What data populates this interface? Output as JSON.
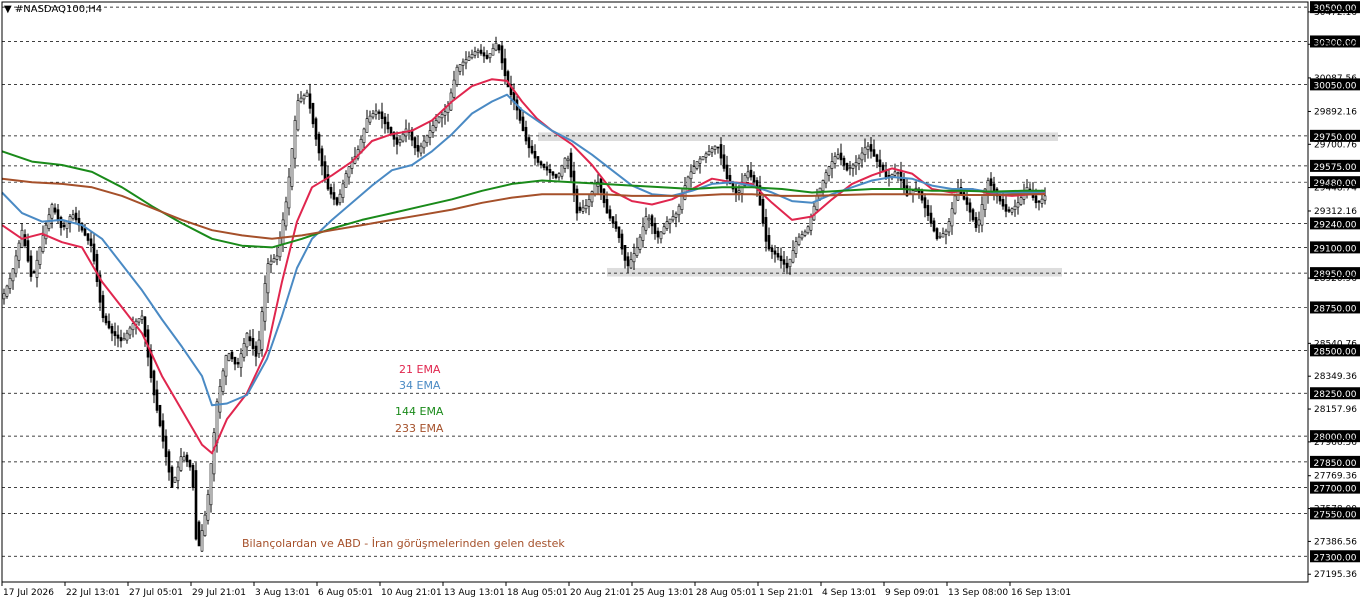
{
  "symbol": "▼ #NASDAQ100,H4",
  "colors": {
    "ema21": "#e0264e",
    "ema34": "#4a8ac4",
    "ema144": "#1a8a1a",
    "ema233": "#a5502a",
    "candle": "#000000",
    "zone": "#d9d9d9",
    "grid": "#000000",
    "note": "#a5502a"
  },
  "legend": {
    "ema21": "21 EMA",
    "ema34": "34 EMA",
    "ema144": "144 EMA",
    "ema233": "233 EMA"
  },
  "annotation": "Bilançolardan ve ABD - İran görüşmelerinden gelen destek",
  "chart_data": {
    "type": "line",
    "y_range": [
      27150,
      30530
    ],
    "x_labels": [
      "17 Jul 2026",
      "22 Jul 13:01",
      "27 Jul 05:01",
      "29 Jul 21:01",
      "3 Aug 13:01",
      "6 Aug 05:01",
      "10 Aug 21:01",
      "13 Aug 13:01",
      "18 Aug 05:01",
      "20 Aug 21:01",
      "25 Aug 13:01",
      "28 Aug 05:01",
      "1 Sep 21:01",
      "4 Sep 13:01",
      "9 Sep 09:01",
      "13 Sep 08:00",
      "16 Sep 13:01"
    ],
    "levels_boxed": [
      "30500.00",
      "30300.00",
      "30050.00",
      "29750.00",
      "29575.00",
      "29480.00",
      "29240.00",
      "29100.00",
      "28950.00",
      "28750.00",
      "28500.00",
      "28250.00",
      "28000.00",
      "27850.00",
      "27700.00",
      "27550.00",
      "27300.00"
    ],
    "levels_plain": [
      "30472.16",
      "30283.70",
      "30087.56",
      "29892.16",
      "29700.76",
      "29448.74",
      "29312.16",
      "28920.96",
      "28540.76",
      "28349.36",
      "28157.96",
      "27966.56",
      "27769.36",
      "27578.00",
      "27386.56",
      "27195.36"
    ],
    "resistance_zone": [
      29720,
      29770
    ],
    "support_zone": [
      28930,
      28980
    ],
    "series": [
      {
        "name": "21 EMA",
        "key": "ema21",
        "points": [
          [
            0,
            29230
          ],
          [
            20,
            29150
          ],
          [
            40,
            29180
          ],
          [
            60,
            29130
          ],
          [
            80,
            29100
          ],
          [
            100,
            28900
          ],
          [
            120,
            28750
          ],
          [
            140,
            28600
          ],
          [
            160,
            28350
          ],
          [
            180,
            28150
          ],
          [
            200,
            27950
          ],
          [
            210,
            27900
          ],
          [
            225,
            28100
          ],
          [
            245,
            28250
          ],
          [
            265,
            28500
          ],
          [
            280,
            28900
          ],
          [
            295,
            29250
          ],
          [
            310,
            29450
          ],
          [
            330,
            29520
          ],
          [
            350,
            29600
          ],
          [
            370,
            29720
          ],
          [
            390,
            29760
          ],
          [
            410,
            29780
          ],
          [
            430,
            29840
          ],
          [
            450,
            29950
          ],
          [
            470,
            30040
          ],
          [
            490,
            30080
          ],
          [
            505,
            30070
          ],
          [
            520,
            29950
          ],
          [
            535,
            29850
          ],
          [
            550,
            29780
          ],
          [
            570,
            29700
          ],
          [
            590,
            29580
          ],
          [
            610,
            29430
          ],
          [
            630,
            29370
          ],
          [
            650,
            29350
          ],
          [
            670,
            29380
          ],
          [
            690,
            29440
          ],
          [
            710,
            29500
          ],
          [
            730,
            29480
          ],
          [
            750,
            29470
          ],
          [
            770,
            29360
          ],
          [
            790,
            29260
          ],
          [
            810,
            29280
          ],
          [
            830,
            29380
          ],
          [
            850,
            29470
          ],
          [
            870,
            29520
          ],
          [
            890,
            29560
          ],
          [
            910,
            29530
          ],
          [
            930,
            29440
          ],
          [
            950,
            29420
          ],
          [
            970,
            29440
          ],
          [
            990,
            29410
          ],
          [
            1010,
            29400
          ],
          [
            1030,
            29410
          ],
          [
            1043,
            29420
          ]
        ]
      },
      {
        "name": "34 EMA",
        "key": "ema34",
        "points": [
          [
            0,
            29420
          ],
          [
            20,
            29300
          ],
          [
            40,
            29250
          ],
          [
            60,
            29260
          ],
          [
            80,
            29230
          ],
          [
            100,
            29150
          ],
          [
            120,
            29000
          ],
          [
            140,
            28850
          ],
          [
            160,
            28680
          ],
          [
            180,
            28520
          ],
          [
            200,
            28350
          ],
          [
            210,
            28180
          ],
          [
            225,
            28190
          ],
          [
            245,
            28240
          ],
          [
            265,
            28450
          ],
          [
            280,
            28700
          ],
          [
            295,
            28980
          ],
          [
            310,
            29150
          ],
          [
            330,
            29260
          ],
          [
            350,
            29360
          ],
          [
            370,
            29460
          ],
          [
            390,
            29550
          ],
          [
            410,
            29580
          ],
          [
            430,
            29660
          ],
          [
            450,
            29760
          ],
          [
            470,
            29880
          ],
          [
            490,
            29950
          ],
          [
            505,
            29990
          ],
          [
            520,
            29900
          ],
          [
            535,
            29840
          ],
          [
            550,
            29780
          ],
          [
            570,
            29720
          ],
          [
            590,
            29640
          ],
          [
            610,
            29550
          ],
          [
            630,
            29460
          ],
          [
            650,
            29410
          ],
          [
            670,
            29400
          ],
          [
            690,
            29430
          ],
          [
            710,
            29470
          ],
          [
            730,
            29480
          ],
          [
            750,
            29460
          ],
          [
            770,
            29420
          ],
          [
            790,
            29370
          ],
          [
            810,
            29360
          ],
          [
            830,
            29410
          ],
          [
            850,
            29450
          ],
          [
            870,
            29490
          ],
          [
            890,
            29510
          ],
          [
            910,
            29500
          ],
          [
            930,
            29460
          ],
          [
            950,
            29440
          ],
          [
            970,
            29440
          ],
          [
            990,
            29420
          ],
          [
            1010,
            29420
          ],
          [
            1030,
            29420
          ],
          [
            1043,
            29425
          ]
        ]
      },
      {
        "name": "144 EMA",
        "key": "ema144",
        "points": [
          [
            0,
            29660
          ],
          [
            30,
            29600
          ],
          [
            60,
            29580
          ],
          [
            90,
            29540
          ],
          [
            120,
            29450
          ],
          [
            150,
            29340
          ],
          [
            180,
            29240
          ],
          [
            210,
            29150
          ],
          [
            240,
            29110
          ],
          [
            270,
            29100
          ],
          [
            300,
            29150
          ],
          [
            330,
            29210
          ],
          [
            360,
            29260
          ],
          [
            390,
            29300
          ],
          [
            420,
            29340
          ],
          [
            450,
            29380
          ],
          [
            480,
            29430
          ],
          [
            510,
            29470
          ],
          [
            540,
            29490
          ],
          [
            570,
            29480
          ],
          [
            600,
            29470
          ],
          [
            630,
            29460
          ],
          [
            660,
            29450
          ],
          [
            690,
            29440
          ],
          [
            720,
            29450
          ],
          [
            750,
            29450
          ],
          [
            780,
            29440
          ],
          [
            810,
            29420
          ],
          [
            840,
            29430
          ],
          [
            870,
            29440
          ],
          [
            900,
            29440
          ],
          [
            930,
            29430
          ],
          [
            960,
            29430
          ],
          [
            990,
            29425
          ],
          [
            1020,
            29430
          ],
          [
            1043,
            29430
          ]
        ]
      },
      {
        "name": "233 EMA",
        "key": "ema233",
        "points": [
          [
            0,
            29500
          ],
          [
            30,
            29480
          ],
          [
            60,
            29470
          ],
          [
            90,
            29450
          ],
          [
            120,
            29400
          ],
          [
            150,
            29330
          ],
          [
            180,
            29260
          ],
          [
            210,
            29200
          ],
          [
            240,
            29170
          ],
          [
            270,
            29150
          ],
          [
            300,
            29170
          ],
          [
            330,
            29200
          ],
          [
            360,
            29230
          ],
          [
            390,
            29260
          ],
          [
            420,
            29290
          ],
          [
            450,
            29320
          ],
          [
            480,
            29360
          ],
          [
            510,
            29390
          ],
          [
            540,
            29410
          ],
          [
            570,
            29410
          ],
          [
            600,
            29410
          ],
          [
            630,
            29400
          ],
          [
            660,
            29400
          ],
          [
            690,
            29400
          ],
          [
            720,
            29410
          ],
          [
            750,
            29410
          ],
          [
            780,
            29400
          ],
          [
            810,
            29400
          ],
          [
            840,
            29405
          ],
          [
            870,
            29410
          ],
          [
            900,
            29410
          ],
          [
            930,
            29410
          ],
          [
            960,
            29405
          ],
          [
            990,
            29405
          ],
          [
            1020,
            29410
          ],
          [
            1043,
            29410
          ]
        ]
      }
    ],
    "price_path": [
      [
        0,
        28800
      ],
      [
        10,
        28950
      ],
      [
        20,
        29200
      ],
      [
        30,
        28900
      ],
      [
        40,
        29150
      ],
      [
        50,
        29350
      ],
      [
        60,
        29200
      ],
      [
        70,
        29300
      ],
      [
        80,
        29200
      ],
      [
        90,
        29100
      ],
      [
        100,
        28700
      ],
      [
        110,
        28600
      ],
      [
        120,
        28550
      ],
      [
        130,
        28650
      ],
      [
        140,
        28700
      ],
      [
        150,
        28300
      ],
      [
        160,
        28000
      ],
      [
        170,
        27700
      ],
      [
        180,
        27900
      ],
      [
        190,
        27800
      ],
      [
        195,
        27300
      ],
      [
        205,
        27600
      ],
      [
        215,
        28200
      ],
      [
        225,
        28500
      ],
      [
        235,
        28400
      ],
      [
        245,
        28600
      ],
      [
        255,
        28450
      ],
      [
        265,
        29000
      ],
      [
        275,
        29050
      ],
      [
        285,
        29400
      ],
      [
        295,
        29950
      ],
      [
        305,
        30000
      ],
      [
        315,
        29700
      ],
      [
        325,
        29450
      ],
      [
        335,
        29350
      ],
      [
        345,
        29550
      ],
      [
        355,
        29650
      ],
      [
        365,
        29850
      ],
      [
        375,
        29900
      ],
      [
        385,
        29800
      ],
      [
        395,
        29700
      ],
      [
        405,
        29800
      ],
      [
        415,
        29650
      ],
      [
        425,
        29750
      ],
      [
        435,
        29850
      ],
      [
        445,
        29900
      ],
      [
        455,
        30150
      ],
      [
        465,
        30200
      ],
      [
        475,
        30250
      ],
      [
        485,
        30200
      ],
      [
        495,
        30300
      ],
      [
        505,
        30050
      ],
      [
        515,
        29900
      ],
      [
        525,
        29700
      ],
      [
        535,
        29600
      ],
      [
        545,
        29550
      ],
      [
        555,
        29500
      ],
      [
        565,
        29650
      ],
      [
        575,
        29300
      ],
      [
        585,
        29350
      ],
      [
        595,
        29500
      ],
      [
        605,
        29300
      ],
      [
        615,
        29200
      ],
      [
        625,
        28980
      ],
      [
        635,
        29100
      ],
      [
        645,
        29300
      ],
      [
        655,
        29150
      ],
      [
        665,
        29250
      ],
      [
        675,
        29300
      ],
      [
        685,
        29500
      ],
      [
        695,
        29600
      ],
      [
        705,
        29650
      ],
      [
        715,
        29700
      ],
      [
        725,
        29500
      ],
      [
        735,
        29400
      ],
      [
        745,
        29550
      ],
      [
        755,
        29450
      ],
      [
        765,
        29100
      ],
      [
        775,
        29050
      ],
      [
        785,
        28980
      ],
      [
        795,
        29150
      ],
      [
        805,
        29200
      ],
      [
        815,
        29400
      ],
      [
        825,
        29550
      ],
      [
        835,
        29650
      ],
      [
        845,
        29550
      ],
      [
        855,
        29600
      ],
      [
        865,
        29700
      ],
      [
        875,
        29600
      ],
      [
        885,
        29500
      ],
      [
        895,
        29550
      ],
      [
        905,
        29400
      ],
      [
        915,
        29450
      ],
      [
        925,
        29300
      ],
      [
        935,
        29150
      ],
      [
        945,
        29200
      ],
      [
        955,
        29450
      ],
      [
        965,
        29350
      ],
      [
        975,
        29200
      ],
      [
        985,
        29500
      ],
      [
        995,
        29400
      ],
      [
        1005,
        29300
      ],
      [
        1015,
        29350
      ],
      [
        1025,
        29450
      ],
      [
        1035,
        29350
      ],
      [
        1043,
        29400
      ]
    ]
  }
}
